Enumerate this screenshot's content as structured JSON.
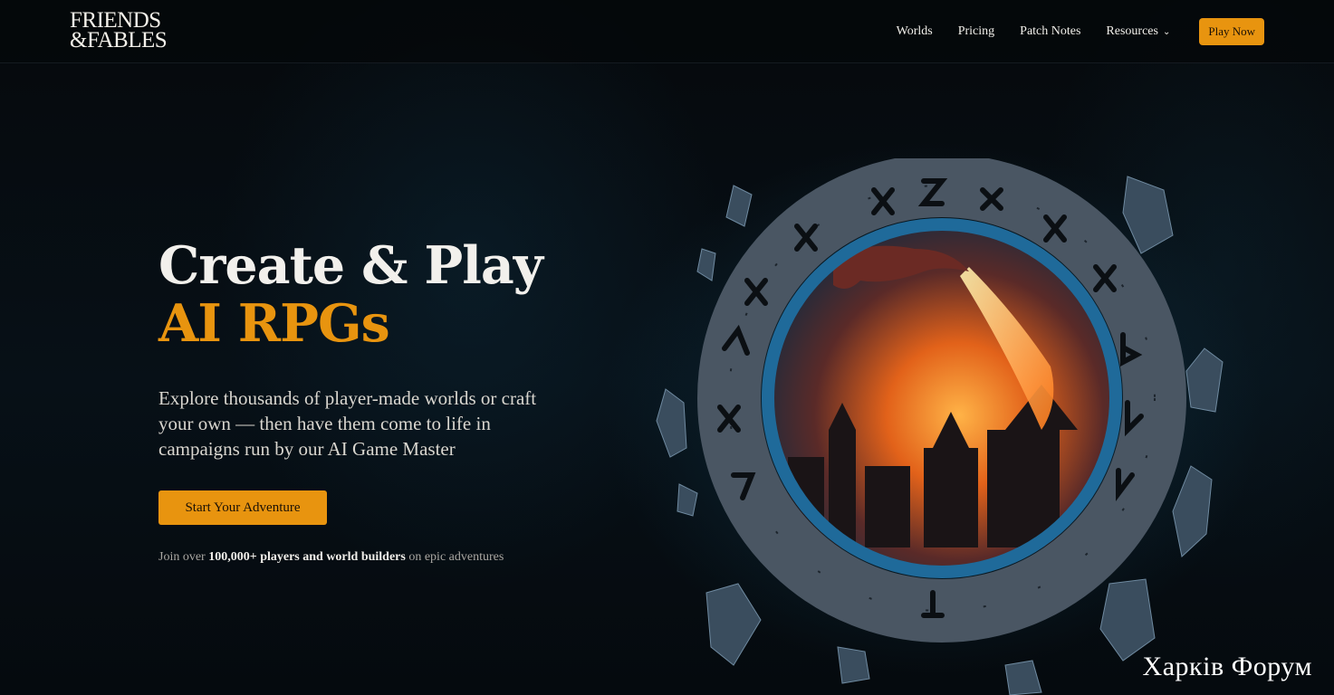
{
  "brand": {
    "line1": "FRIENDS",
    "line2": "&FABLES"
  },
  "nav": {
    "items": [
      {
        "label": "Worlds"
      },
      {
        "label": "Pricing"
      },
      {
        "label": "Patch Notes"
      },
      {
        "label": "Resources",
        "icon": "chevron-down-icon"
      }
    ],
    "cta_label": "Play Now"
  },
  "hero": {
    "title_line1": "Create & Play",
    "title_line2": "AI RPGs",
    "subtitle": "Explore thousands of player-made worlds or craft your own — then have them come to life in campaigns run by our AI Game Master",
    "cta_label": "Start Your Adventure",
    "join_prefix": "Join over",
    "join_bold": "100,000+ players and world builders",
    "join_suffix": "on epic adventures"
  },
  "watermark": "Харків Форум",
  "colors": {
    "accent": "#e8940f",
    "background": "#05090d",
    "text": "#f2f0ec"
  }
}
